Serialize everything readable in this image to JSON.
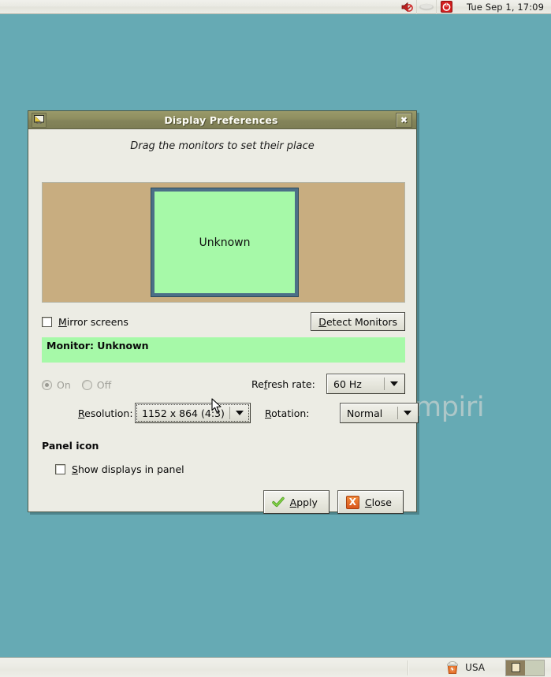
{
  "top_panel": {
    "tray": [
      {
        "name": "volume-muted-icon",
        "label": "volume-muted-icon"
      },
      {
        "name": "blank-applet-icon",
        "label": "blank-applet-icon"
      },
      {
        "name": "power-icon",
        "label": "power-icon"
      }
    ],
    "clock": "Tue Sep  1, 17:09"
  },
  "desktop": {
    "background_color": "#66aab4",
    "watermark": "Napalmpiri"
  },
  "dialog": {
    "icon": "display-monitor-icon",
    "title": "Display Preferences",
    "close_button_glyph": "✖",
    "hint": "Drag the monitors to set their place",
    "monitor_area": {
      "background_color": "#c8ad80",
      "monitor": {
        "label": "Unknown",
        "screen_color": "#a6f9a8",
        "frame_color": "#4c6f87"
      }
    },
    "mirror_screens": {
      "label_prefix": "M",
      "label_rest": "irror screens",
      "checked": false
    },
    "detect_monitors": {
      "label_prefix": "D",
      "label_rest": "etect Monitors"
    },
    "monitor_bar": {
      "title": "Monitor: Unknown",
      "subtitle": "",
      "background_color": "#a6f9a8"
    },
    "power": {
      "on_label": "On",
      "off_label": "Off",
      "selected": "On",
      "disabled": true
    },
    "refresh_rate": {
      "label_prefix": "Re",
      "label_mid": "f",
      "label_rest": "resh rate:",
      "value": "60 Hz"
    },
    "resolution": {
      "label_prefix": "R",
      "label_rest": "esolution:",
      "value": "1152 x 864 (4:3)",
      "focused": true
    },
    "rotation": {
      "label_prefix": "R",
      "label_rest": "otation:",
      "value": "Normal"
    },
    "panel_icon_heading": "Panel icon",
    "show_displays_in_panel": {
      "label_prefix": "S",
      "label_rest": "how displays in panel",
      "checked": false
    },
    "apply_button": {
      "icon": "green-check-icon",
      "label_prefix": "A",
      "label_rest": "pply"
    },
    "close_button": {
      "icon": "orange-x-icon",
      "icon_glyph": "X",
      "label_prefix": "C",
      "label_rest": "lose"
    }
  },
  "bottom_panel": {
    "trash": {
      "icon": "trash-icon",
      "label": "USA"
    },
    "workspaces": [
      {
        "name": "workspace-1",
        "active": true
      },
      {
        "name": "workspace-2",
        "active": false
      }
    ]
  }
}
